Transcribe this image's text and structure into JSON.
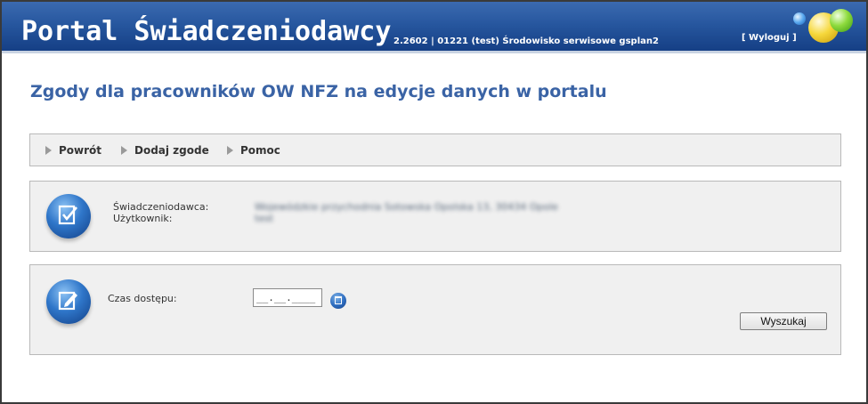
{
  "header": {
    "title": "Portal Świadczeniodawcy",
    "version": "2.2602 | 01221 (test) Środowisko serwisowe gsplan2",
    "logout_label": "[ Wyloguj ]"
  },
  "page": {
    "title": "Zgody dla pracowników OW NFZ na edycje danych w portalu"
  },
  "toolbar": {
    "items": [
      {
        "label": "Powrót"
      },
      {
        "label": "Dodaj zgode"
      },
      {
        "label": "Pomoc"
      }
    ]
  },
  "info": {
    "provider_label": "Świadczeniodawca:",
    "provider_value_line1": "Wojewódzkie przychodnia Sotowska Opolska 13, 30434 Opole",
    "provider_value_line2": "test",
    "user_label": "Użytkownik:"
  },
  "search": {
    "access_time_label": "Czas dostępu:",
    "date_value": "__.__.____",
    "search_button_label": "Wyszukaj"
  },
  "colors": {
    "header_blue": "#27579f",
    "title_blue": "#3a63a5"
  },
  "icons": {
    "info_icon": "document-check-icon",
    "search_icon": "document-edit-icon",
    "calendar": "calendar-icon",
    "toolbar_arrow": "arrow-right-icon"
  }
}
